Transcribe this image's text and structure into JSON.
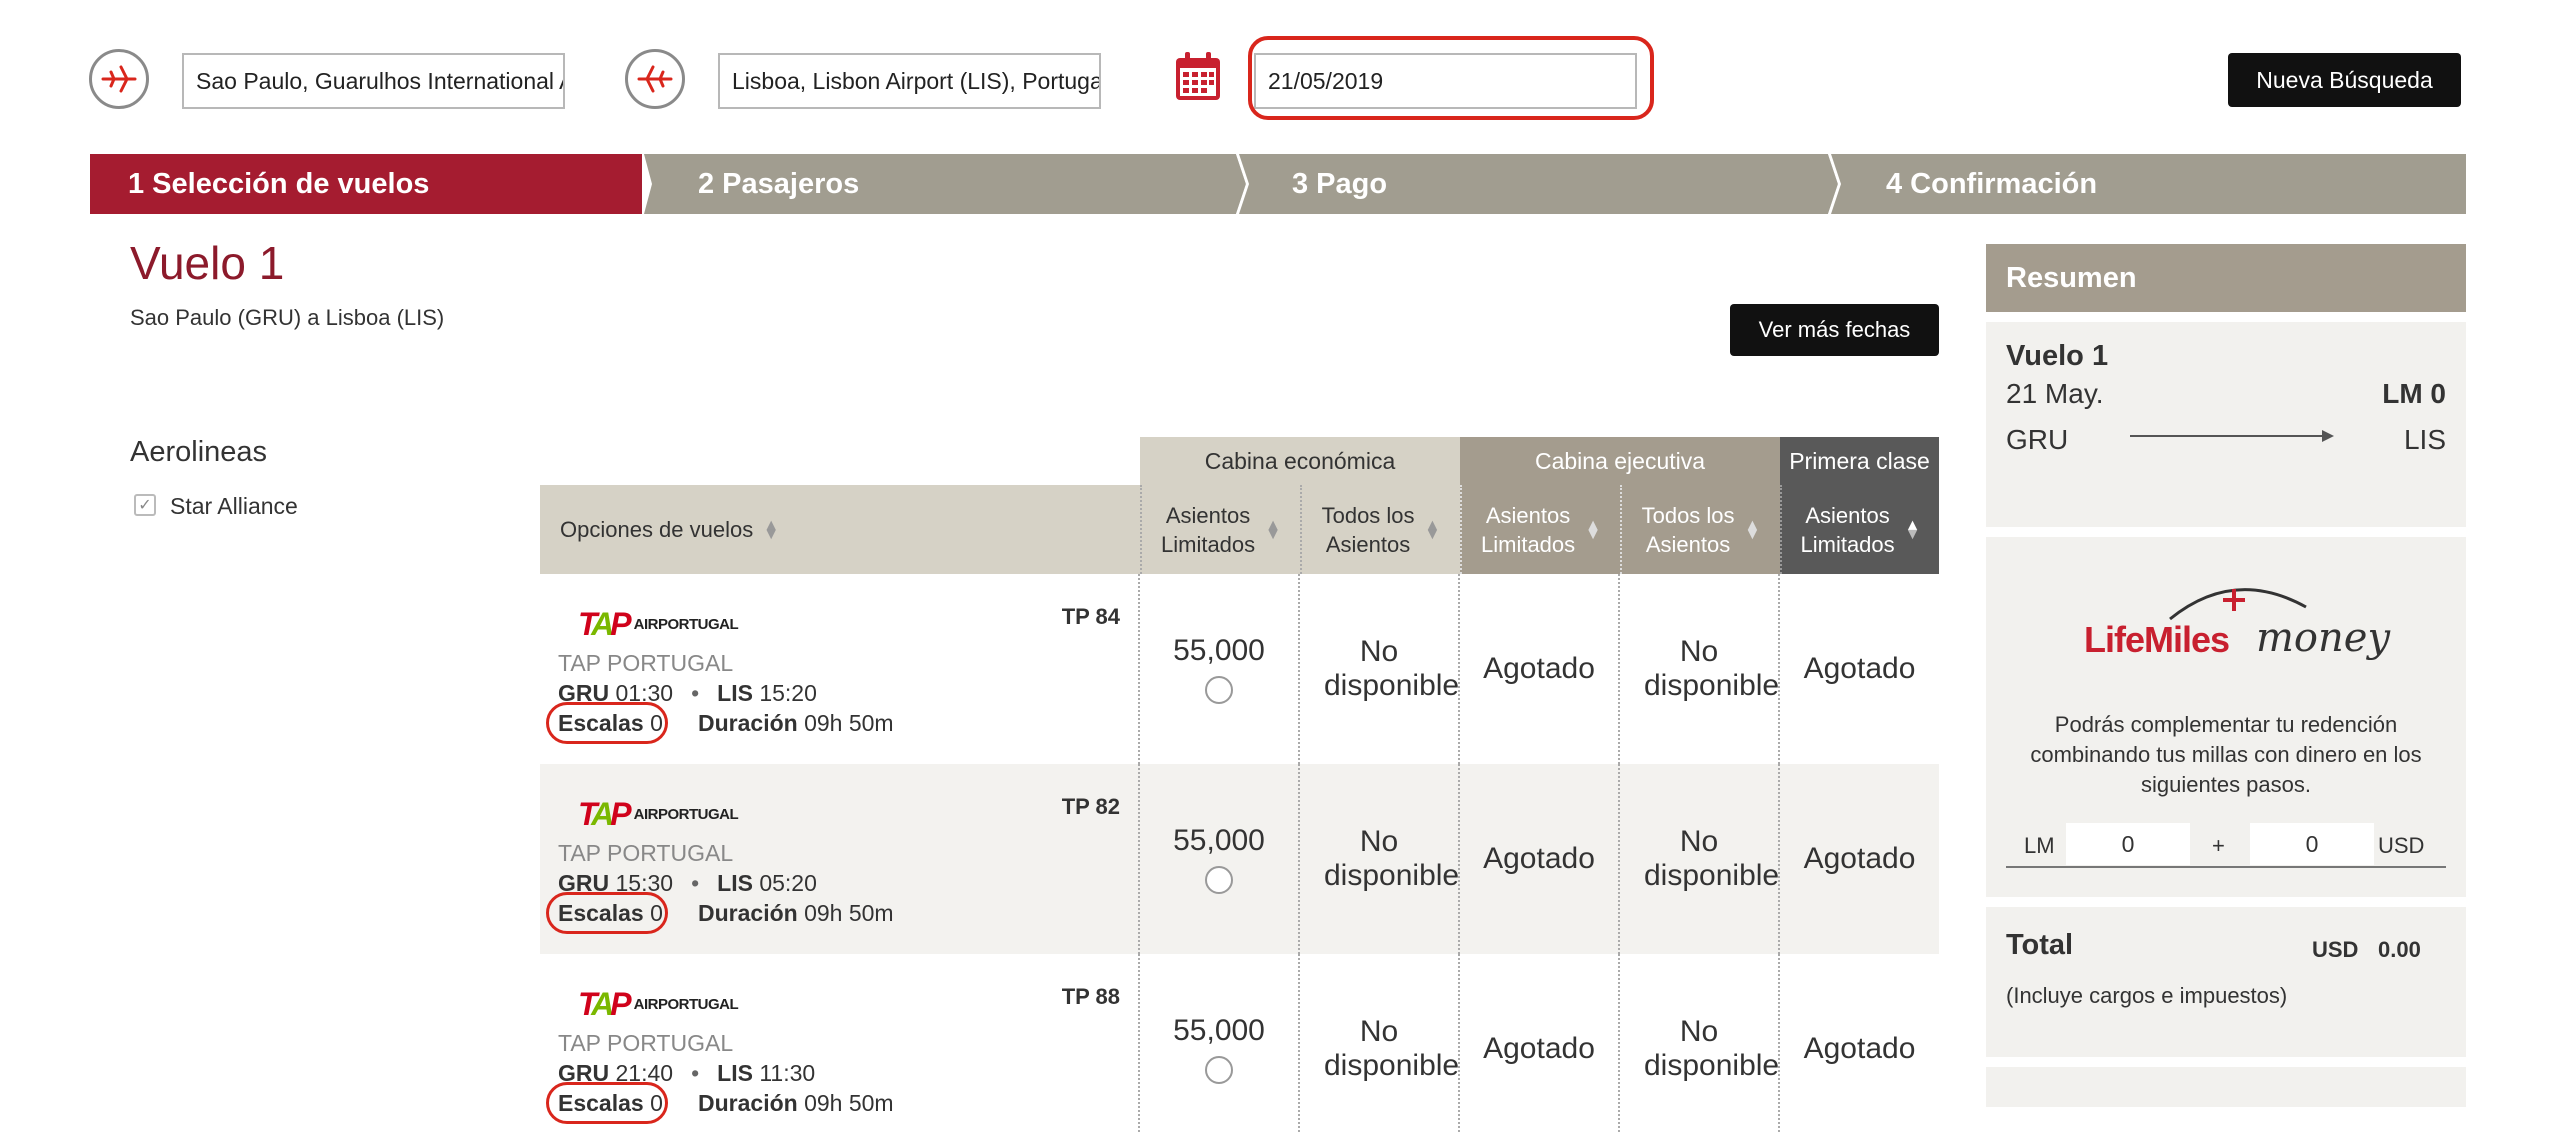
{
  "search": {
    "origin_value": "Sao Paulo, Guarulhos International A",
    "destination_value": "Lisboa, Lisbon Airport (LIS), Portugal",
    "date_value": "21/05/2019",
    "new_search_label": "Nueva Búsqueda",
    "origin_icon": "plane-takeoff-icon",
    "destination_icon": "plane-landing-icon",
    "calendar_icon": "calendar-icon"
  },
  "steps": [
    {
      "label": "1 Selección de vuelos",
      "active": true
    },
    {
      "label": "2 Pasajeros",
      "active": false
    },
    {
      "label": "3 Pago",
      "active": false
    },
    {
      "label": "4 Confirmación",
      "active": false
    }
  ],
  "flight": {
    "title": "Vuelo 1",
    "route": "Sao Paulo (GRU) a Lisboa (LIS)",
    "more_dates_label": "Ver más fechas"
  },
  "filters": {
    "title": "Aerolineas",
    "alliance_label": "Star Alliance",
    "alliance_checked": true
  },
  "table": {
    "cabins": {
      "economy": "Cabina económica",
      "business": "Cabina ejecutiva",
      "first": "Primera clase"
    },
    "options_header": "Opciones de vuelos",
    "col_limited_1": "Asientos",
    "col_limited_2": "Limitados",
    "col_all_1": "Todos los",
    "col_all_2": "Asientos",
    "stops_label": "Escalas",
    "duration_label": "Duración",
    "airline_logo_text": "AIRPORTUGAL",
    "rows": [
      {
        "flight_no": "TP 84",
        "carrier": "TAP PORTUGAL",
        "dep_code": "GRU",
        "dep_time": "01:30",
        "arr_code": "LIS",
        "arr_time": "15:20",
        "stops": "0",
        "duration": "09h 50m",
        "eco_limited": "55,000",
        "eco_all": "No disponible",
        "biz_limited": "Agotado",
        "biz_all": "No disponible",
        "first_limited": "Agotado"
      },
      {
        "flight_no": "TP 82",
        "carrier": "TAP PORTUGAL",
        "dep_code": "GRU",
        "dep_time": "15:30",
        "arr_code": "LIS",
        "arr_time": "05:20",
        "stops": "0",
        "duration": "09h 50m",
        "eco_limited": "55,000",
        "eco_all": "No disponible",
        "biz_limited": "Agotado",
        "biz_all": "No disponible",
        "first_limited": "Agotado"
      },
      {
        "flight_no": "TP 88",
        "carrier": "TAP PORTUGAL",
        "dep_code": "GRU",
        "dep_time": "21:40",
        "arr_code": "LIS",
        "arr_time": "11:30",
        "stops": "0",
        "duration": "09h 50m",
        "eco_limited": "55,000",
        "eco_all": "No disponible",
        "biz_limited": "Agotado",
        "biz_all": "No disponible",
        "first_limited": "Agotado"
      }
    ]
  },
  "summary": {
    "title": "Resumen",
    "flight_label": "Vuelo 1",
    "date": "21 May.",
    "miles": "LM 0",
    "from": "GRU",
    "to": "LIS",
    "lifemiles_brand": "LifeMiles",
    "money_brand": "money",
    "combine_text": "Podrás complementar tu redención combinando tus millas con dinero en los siguientes pasos.",
    "lm_label": "LM",
    "lm_value": "0",
    "plus": "+",
    "usd_value": "0",
    "usd_label": "USD",
    "total_label": "Total",
    "total_currency": "USD",
    "total_amount": "0.00",
    "total_note": "(Incluye cargos e impuestos)"
  },
  "colors": {
    "brand_red": "#a51c30",
    "title_red": "#8c1a2b",
    "step_gray": "#a19d90",
    "highlight_red": "#d9261c",
    "economy_bg": "#d6d2c6",
    "business_bg": "#a49c8e",
    "first_bg": "#595959"
  }
}
